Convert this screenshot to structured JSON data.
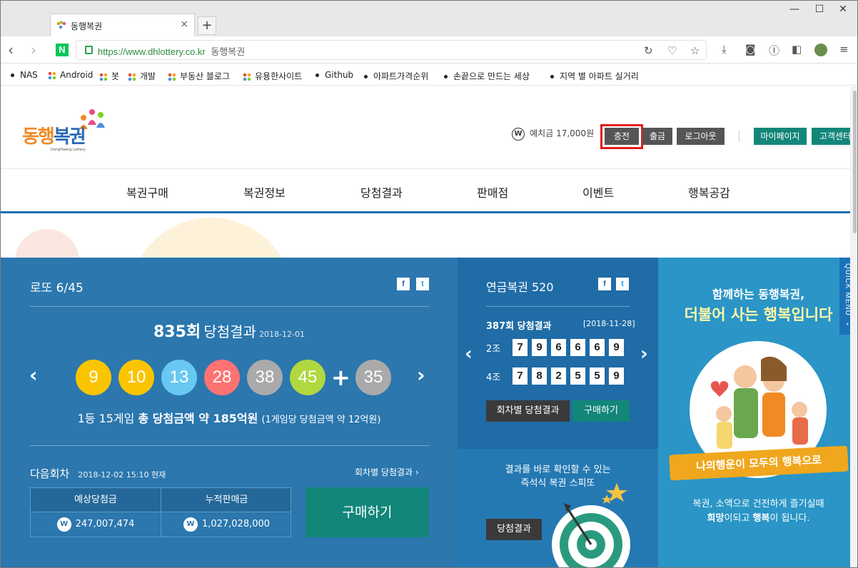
{
  "browser": {
    "tab_title": "동행복권",
    "tab_close": "×",
    "new_tab": "+",
    "url": "https://www.dhlottery.co.kr",
    "url_title": "동행복권",
    "naver_logo": "N"
  },
  "bookmarks": [
    {
      "label": "NAS",
      "icon": "dot"
    },
    {
      "label": "Android",
      "icon": "folder"
    },
    {
      "label": "봇",
      "icon": "folder"
    },
    {
      "label": "개발",
      "icon": "folder"
    },
    {
      "label": "부동산 블로그",
      "icon": "folder"
    },
    {
      "label": "유용한사이트",
      "icon": "folder"
    },
    {
      "label": "Github",
      "icon": "dot"
    },
    {
      "label": "아파트가격순위",
      "icon": "dot"
    },
    {
      "label": "손끝으로 만드는 세상",
      "icon": "dot"
    },
    {
      "label": "지역 별 아파트 실거리",
      "icon": "dot"
    }
  ],
  "site": {
    "logo_main": "동행",
    "logo_accent": "복권",
    "logo_sub": "DongHaeng Lottery",
    "coin": "W",
    "balance": "예치금 17,000원",
    "charge": "충전",
    "withdraw": "출금",
    "logout": "로그아웃",
    "mypage": "마이페이지",
    "support": "고객센터"
  },
  "nav": [
    "복권구매",
    "복권정보",
    "당첨결과",
    "판매점",
    "이벤트",
    "행복공감"
  ],
  "lotto": {
    "title": "로또 6/45",
    "round": "835회",
    "result_label": "당첨결과",
    "date": "2018-12-01",
    "balls": [
      {
        "n": "9",
        "color": "#fbc400"
      },
      {
        "n": "10",
        "color": "#fbc400"
      },
      {
        "n": "13",
        "color": "#69c8f2"
      },
      {
        "n": "28",
        "color": "#ff7272"
      },
      {
        "n": "38",
        "color": "#aaaaaa"
      },
      {
        "n": "45",
        "color": "#b0d840"
      }
    ],
    "plus": "+",
    "bonus": {
      "n": "35",
      "color": "#aaaaaa"
    },
    "summary_a": "1등 15게임",
    "summary_b": "총 당첨금액 약 185억원",
    "summary_c": "(1게임당 당첨금액 약 12억원)",
    "next_label": "다음회차",
    "next_time": "2018-12-02 15:10 현재",
    "history_link": "회차별 당첨결과",
    "expected_label": "예상당첨금",
    "cumulative_label": "누적판매금",
    "expected_value": "247,007,474",
    "cumulative_value": "1,027,028,000",
    "buy": "구매하기"
  },
  "pension": {
    "title": "연금복권 520",
    "round_result": "387회 당첨결과",
    "date": "[2018-11-28]",
    "rows": [
      {
        "group": "2조",
        "digits": [
          "7",
          "9",
          "6",
          "6",
          "6",
          "9"
        ]
      },
      {
        "group": "4조",
        "digits": [
          "7",
          "8",
          "2",
          "5",
          "5",
          "9"
        ]
      }
    ],
    "history": "회차별 당첨결과",
    "buy": "구매하기"
  },
  "speetto": {
    "line1": "결과를 바로 확인할 수 있는",
    "line2": "즉석식 복권 스피또",
    "result": "당첨결과"
  },
  "happy": {
    "line1": "함께하는 동행복권,",
    "line2": "더불어 사는 행복입니다",
    "ribbon": "나의행운이 모두의 행복으로",
    "desc1": "복권, 소액으로 건전하게 즐기실때",
    "desc2_a": "희망",
    "desc2_b": "이되고 ",
    "desc2_c": "행복",
    "desc2_d": "이 됩니다."
  },
  "quickmenu": "QUICK MENU",
  "colors": {
    "brand_orange": "#f08a24",
    "brand_blue": "#2a6ab6",
    "panel_blue": "#2b77ae",
    "green": "#13867a",
    "highlight_red": "#e21b1b"
  }
}
